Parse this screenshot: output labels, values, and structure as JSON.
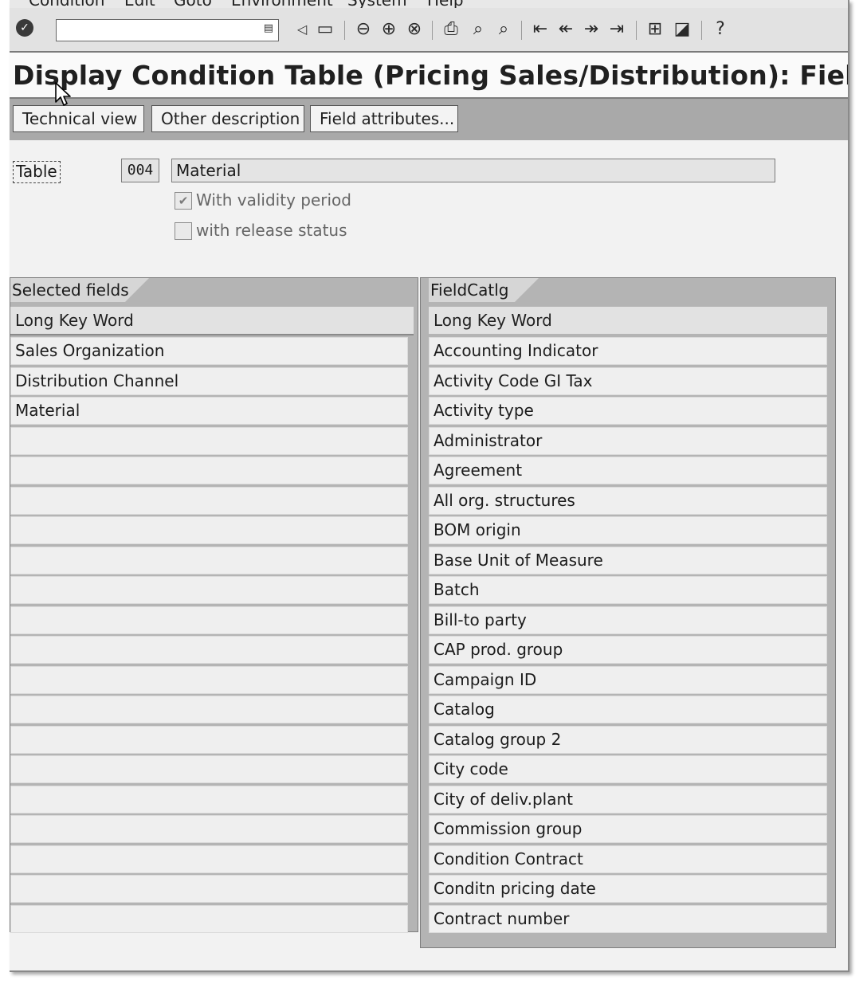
{
  "menu": {
    "items": [
      "Condition",
      "Edit",
      "Goto",
      "Environment",
      "System",
      "Help"
    ]
  },
  "toolbar": {
    "command_field": {
      "value": "",
      "placeholder": ""
    },
    "icons": [
      "enter-icon",
      "back-arrow-icon",
      "save-icon",
      "back-icon",
      "exit-icon",
      "cancel-icon",
      "print-icon",
      "find-icon",
      "find-next-icon",
      "first-page-icon",
      "previous-page-icon",
      "next-page-icon",
      "last-page-icon",
      "create-session-icon",
      "shortcut-icon",
      "help-icon"
    ]
  },
  "title": "Display Condition Table (Pricing Sales/Distribution): Field Overv",
  "app_toolbar": {
    "technical_view": "Technical view",
    "other_description": "Other description",
    "field_attributes": "Field attributes..."
  },
  "header": {
    "table_label": "Table",
    "table_number": "004",
    "table_description": "Material",
    "validity_period": {
      "label": "With validity period",
      "checked": true
    },
    "release_status": {
      "label": "with release status",
      "checked": false
    }
  },
  "selected_fields": {
    "tab_label": "Selected fields",
    "column_header": "Long Key Word",
    "rows": [
      "Sales Organization",
      "Distribution Channel",
      "Material",
      "",
      "",
      "",
      "",
      "",
      "",
      "",
      "",
      "",
      "",
      "",
      "",
      "",
      "",
      "",
      "",
      ""
    ]
  },
  "field_catalog": {
    "tab_label": "FieldCatlg",
    "column_header": "Long Key Word",
    "rows": [
      "Accounting Indicator",
      "Activity Code GI Tax",
      "Activity type",
      "Administrator",
      "Agreement",
      "All org. structures",
      "BOM origin",
      "Base Unit of Measure",
      "Batch",
      "Bill-to party",
      "CAP prod. group",
      "Campaign ID",
      "Catalog",
      "Catalog group 2",
      "City code",
      "City of deliv.plant",
      "Commission group",
      "Condition Contract",
      "Conditn pricing date",
      "Contract number"
    ]
  }
}
